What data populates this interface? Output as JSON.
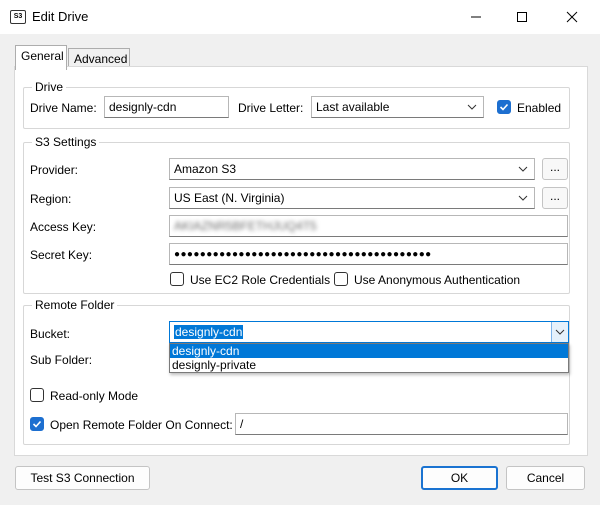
{
  "window": {
    "app_icon_text": "S3",
    "title": "Edit Drive"
  },
  "tabs": [
    {
      "label": "General",
      "active": true
    },
    {
      "label": "Advanced",
      "active": false
    }
  ],
  "drive": {
    "group_title": "Drive",
    "name_label": "Drive Name:",
    "name_value": "designly-cdn",
    "letter_label": "Drive Letter:",
    "letter_value": "Last available",
    "enabled_label": "Enabled",
    "enabled_checked": true
  },
  "s3": {
    "group_title": "S3 Settings",
    "provider_label": "Provider:",
    "provider_value": "Amazon S3",
    "region_label": "Region:",
    "region_value": "US East (N. Virginia)",
    "access_key_label": "Access Key:",
    "access_key_value": "AKIAZNR5BFETHJUQ4T5",
    "secret_key_label": "Secret Key:",
    "secret_key_value": "●●●●●●●●●●●●●●●●●●●●●●●●●●●●●●●●●●●●●●●●",
    "ec2_label": "Use EC2 Role Credentials",
    "anon_label": "Use Anonymous Authentication",
    "dots": "..."
  },
  "remote": {
    "group_title": "Remote Folder",
    "bucket_label": "Bucket:",
    "bucket_value": "designly-cdn",
    "bucket_options": [
      "designly-cdn",
      "designly-private"
    ],
    "subfolder_label": "Sub Folder:",
    "readonly_label": "Read-only Mode",
    "open_label": "Open Remote Folder On Connect:",
    "open_checked": true,
    "open_path": "/"
  },
  "buttons": {
    "test": "Test S3 Connection",
    "ok": "OK",
    "cancel": "Cancel"
  },
  "colors": {
    "accent": "#1d6fd0",
    "selection": "#0078d7"
  }
}
